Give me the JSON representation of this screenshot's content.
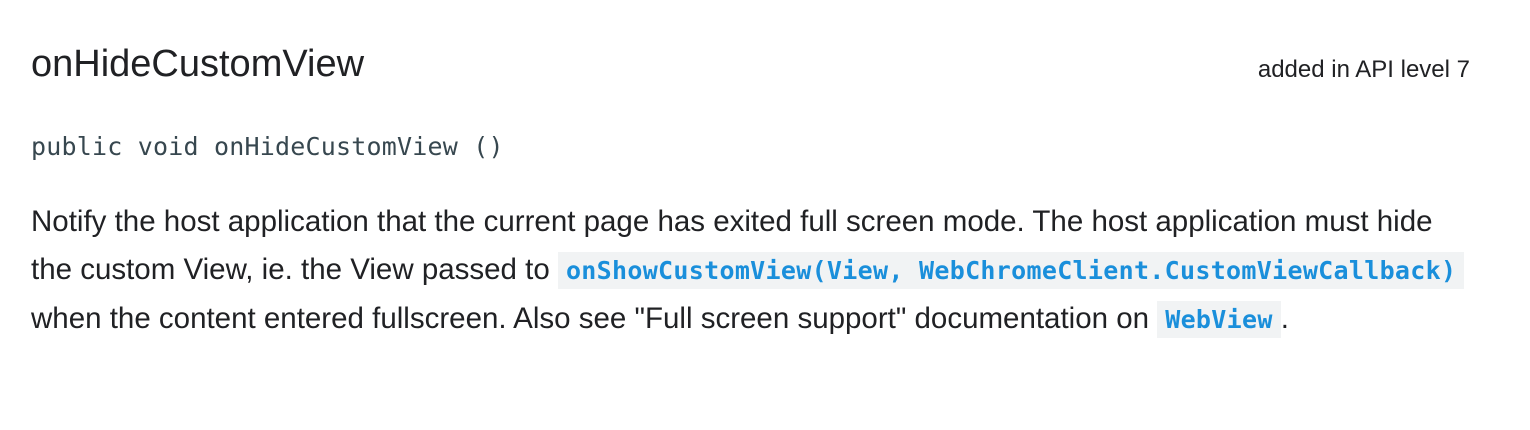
{
  "method": {
    "title": "onHideCustomView",
    "api_level": "added in API level 7",
    "signature": "public void onHideCustomView ()",
    "description": {
      "part1": "Notify the host application that the current page has exited full screen mode. The host application must hide the custom View, ie. the View passed to ",
      "link1": "onShowCustomView(View, WebChromeClient.CustomViewCallback)",
      "part2": " when the content entered fullscreen. Also see \"Full screen support\" documentation on ",
      "link2": "WebView",
      "part3": "."
    }
  },
  "colors": {
    "link": "#1a8fdb",
    "code_background": "#f1f3f4",
    "text": "#202124"
  }
}
